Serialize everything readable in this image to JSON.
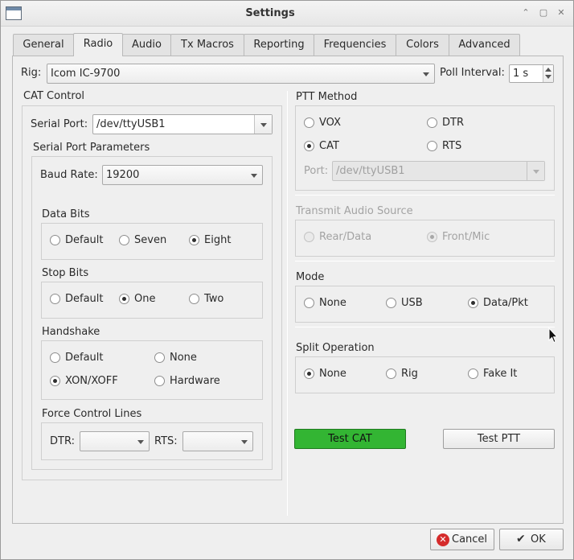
{
  "window": {
    "title": "Settings"
  },
  "tabs": [
    {
      "label": "General",
      "active": false
    },
    {
      "label": "Radio",
      "active": true
    },
    {
      "label": "Audio",
      "active": false
    },
    {
      "label": "Tx Macros",
      "active": false
    },
    {
      "label": "Reporting",
      "active": false
    },
    {
      "label": "Frequencies",
      "active": false
    },
    {
      "label": "Colors",
      "active": false
    },
    {
      "label": "Advanced",
      "active": false
    }
  ],
  "rig": {
    "label": "Rig:",
    "value": "Icom IC-9700"
  },
  "poll": {
    "label": "Poll Interval:",
    "value": "1 s"
  },
  "cat": {
    "title": "CAT Control",
    "serial_port_label": "Serial Port:",
    "serial_port_value": "/dev/ttyUSB1",
    "params_title": "Serial Port Parameters",
    "baud_label": "Baud Rate:",
    "baud_value": "19200",
    "data_bits": {
      "title": "Data Bits",
      "options": [
        "Default",
        "Seven",
        "Eight"
      ],
      "selected": "Eight"
    },
    "stop_bits": {
      "title": "Stop Bits",
      "options": [
        "Default",
        "One",
        "Two"
      ],
      "selected": "One"
    },
    "handshake": {
      "title": "Handshake",
      "options": [
        "Default",
        "None",
        "XON/XOFF",
        "Hardware"
      ],
      "selected": "XON/XOFF"
    },
    "force": {
      "title": "Force Control Lines",
      "dtr_label": "DTR:",
      "dtr_value": "",
      "rts_label": "RTS:",
      "rts_value": ""
    }
  },
  "ptt": {
    "title": "PTT Method",
    "options": [
      "VOX",
      "DTR",
      "CAT",
      "RTS"
    ],
    "selected": "CAT",
    "port_label": "Port:",
    "port_value": "/dev/ttyUSB1"
  },
  "tx_audio": {
    "title": "Transmit Audio Source",
    "options": [
      "Rear/Data",
      "Front/Mic"
    ],
    "selected": "Front/Mic"
  },
  "mode": {
    "title": "Mode",
    "options": [
      "None",
      "USB",
      "Data/Pkt"
    ],
    "selected": "Data/Pkt"
  },
  "split": {
    "title": "Split Operation",
    "options": [
      "None",
      "Rig",
      "Fake It"
    ],
    "selected": "None"
  },
  "buttons": {
    "test_cat": "Test CAT",
    "test_ptt": "Test PTT",
    "cancel": "Cancel",
    "ok": "OK"
  },
  "colors": {
    "test_cat_bg": "#33b533"
  }
}
